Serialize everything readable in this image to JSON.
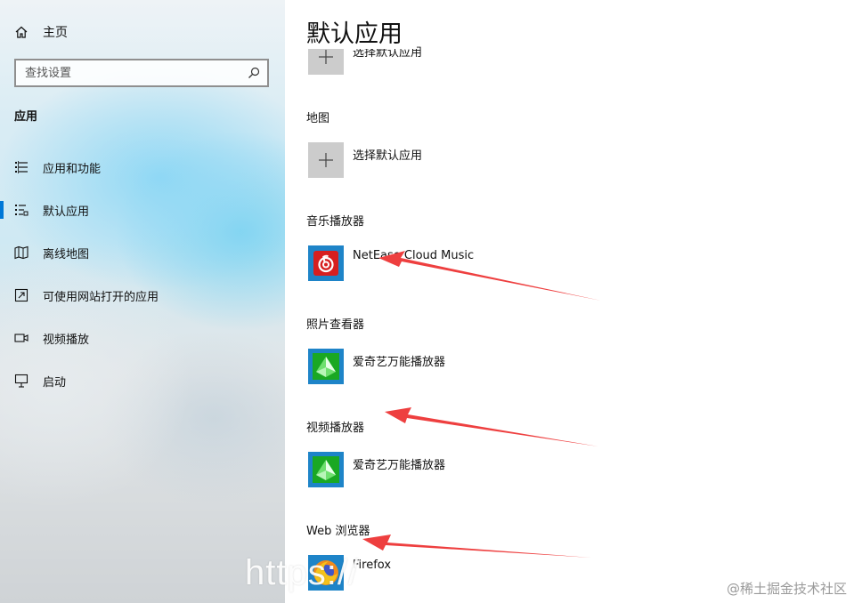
{
  "sidebar": {
    "home_label": "主页",
    "search_placeholder": "查找设置",
    "section_title": "应用",
    "items": [
      {
        "label": "应用和功能",
        "icon": "apps-features-icon"
      },
      {
        "label": "默认应用",
        "icon": "default-apps-icon",
        "active": true
      },
      {
        "label": "离线地图",
        "icon": "offline-maps-icon"
      },
      {
        "label": "可使用网站打开的应用",
        "icon": "apps-for-websites-icon"
      },
      {
        "label": "视频播放",
        "icon": "video-playback-icon"
      },
      {
        "label": "启动",
        "icon": "startup-icon"
      }
    ],
    "accent_color": "#0078d7"
  },
  "main": {
    "title": "默认应用",
    "sections": [
      {
        "category": "",
        "app": "选择默认应用",
        "icon": "plus-icon"
      },
      {
        "category": "地图",
        "app": "选择默认应用",
        "icon": "plus-icon"
      },
      {
        "category": "音乐播放器",
        "app": "NetEase Cloud Music",
        "icon": "netease-cloud-music-icon"
      },
      {
        "category": "照片查看器",
        "app": "爱奇艺万能播放器",
        "icon": "iqiyi-player-icon"
      },
      {
        "category": "视频播放器",
        "app": "爱奇艺万能播放器",
        "icon": "iqiyi-player-icon"
      },
      {
        "category": "Web 浏览器",
        "app": "Firefox",
        "icon": "firefox-icon"
      }
    ]
  },
  "overlay": {
    "url_watermark": "https://",
    "site_watermark": "@稀土掘金技术社区",
    "arrow_color": "#ee3f3f"
  }
}
